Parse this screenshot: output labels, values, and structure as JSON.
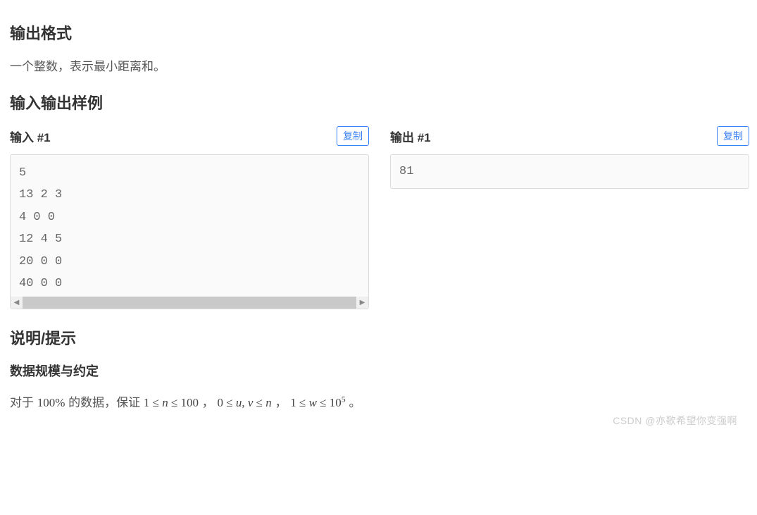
{
  "sections": {
    "output_format": {
      "title": "输出格式",
      "desc": "一个整数，表示最小距离和。"
    },
    "samples": {
      "title": "输入输出样例",
      "input_label": "输入 #1",
      "output_label": "输出 #1",
      "copy_label": "复制",
      "input_content": "5\n13 2 3\n4 0 0\n12 4 5\n20 0 0\n40 0 0",
      "output_content": "81"
    },
    "notes": {
      "title": "说明/提示",
      "subtitle": "数据规模与约定",
      "constraint_prefix": "对于 ",
      "percent": "100%",
      "constraint_mid1": " 的数据，保证 ",
      "c1": "1 ≤ n ≤ 100",
      "sep": "，",
      "c2": "0 ≤ u, v ≤ n",
      "c3_a": "1 ≤ w ≤ 10",
      "c3_exp": "5",
      "period": " 。"
    }
  },
  "watermark": "CSDN @亦歌希望你变强啊"
}
